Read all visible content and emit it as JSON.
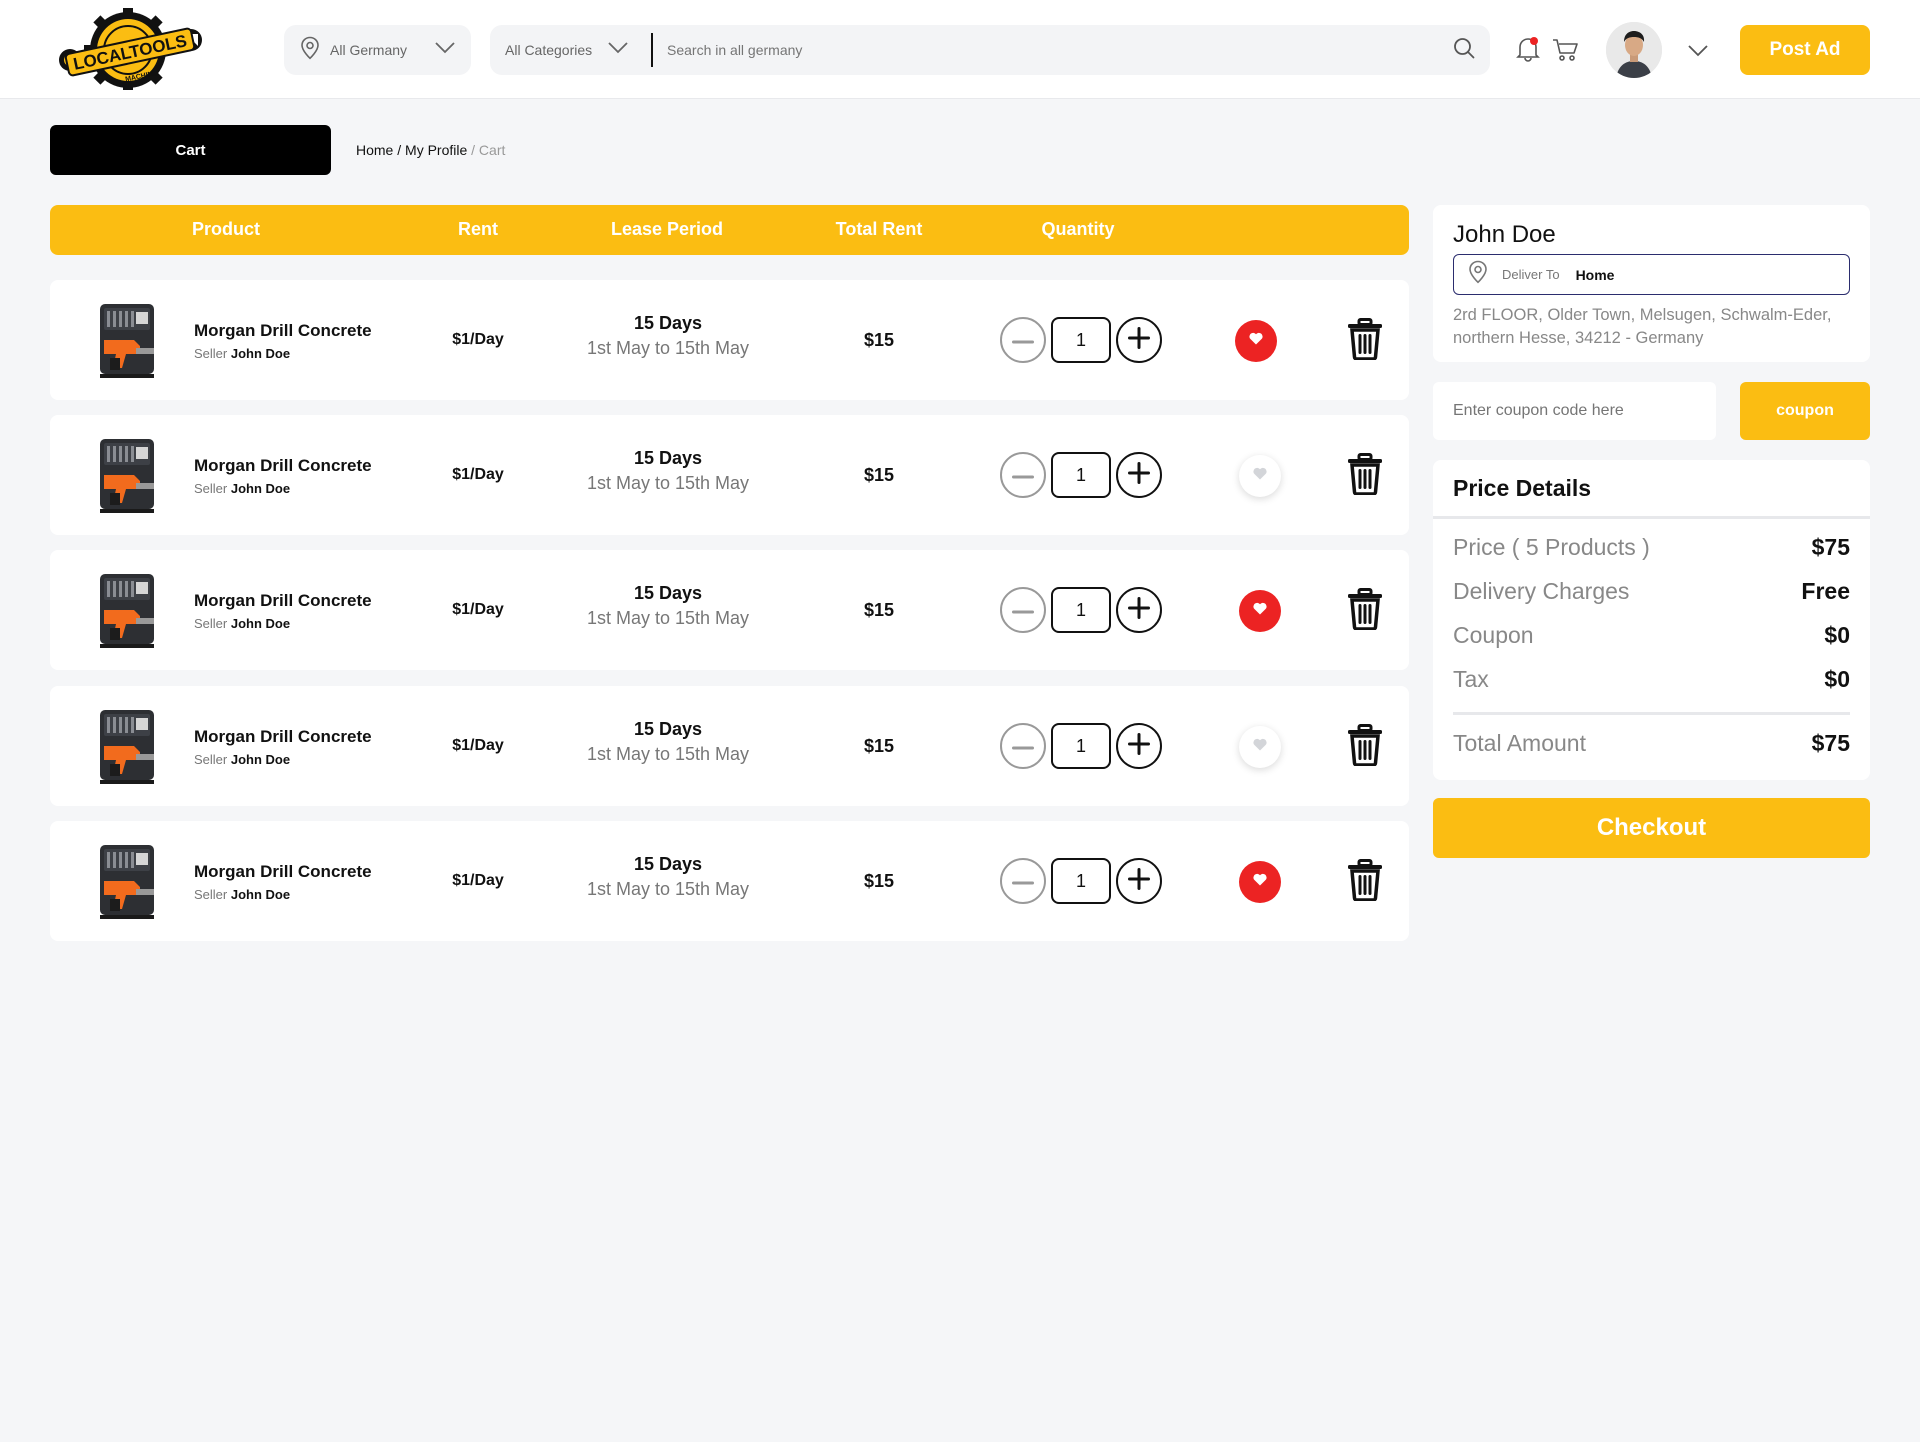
{
  "brand": {
    "logo_text": "LOCALTOOLS",
    "logo_subtext": "MACHINE"
  },
  "header": {
    "location": "All Germany",
    "category": "All Categories",
    "search_placeholder": "Search in all germany",
    "post_ad_label": "Post Ad"
  },
  "page": {
    "tab_label": "Cart",
    "breadcrumb_home": "Home",
    "breadcrumb_sep1": " / ",
    "breadcrumb_profile": "My Profile",
    "breadcrumb_current": " / Cart"
  },
  "table": {
    "columns": [
      "Product",
      "Rent",
      "Lease Period",
      "Total Rent",
      "Quantity"
    ],
    "rows": [
      {
        "product": "Morgan Drill Concrete",
        "seller_label": "Seller",
        "seller": "John Doe",
        "rent": "$1/Day",
        "days": "15 Days",
        "range": "1st May to 15th May",
        "total": "$15",
        "quantity": "1",
        "favorite": true
      },
      {
        "product": "Morgan Drill Concrete",
        "seller_label": "Seller",
        "seller": "John Doe",
        "rent": "$1/Day",
        "days": "15 Days",
        "range": "1st May to 15th May",
        "total": "$15",
        "quantity": "1",
        "favorite": false
      },
      {
        "product": "Morgan Drill Concrete",
        "seller_label": "Seller",
        "seller": "John Doe",
        "rent": "$1/Day",
        "days": "15 Days",
        "range": "1st May to 15th May",
        "total": "$15",
        "quantity": "1",
        "favorite": true
      },
      {
        "product": "Morgan Drill Concrete",
        "seller_label": "Seller",
        "seller": "John Doe",
        "rent": "$1/Day",
        "days": "15 Days",
        "range": "1st May to 15th May",
        "total": "$15",
        "quantity": "1",
        "favorite": false
      },
      {
        "product": "Morgan Drill Concrete",
        "seller_label": "Seller",
        "seller": "John Doe",
        "rent": "$1/Day",
        "days": "15 Days",
        "range": "1st May to 15th May",
        "total": "$15",
        "quantity": "1",
        "favorite": true
      }
    ]
  },
  "address": {
    "name": "John Doe",
    "deliver_label": "Deliver To",
    "deliver_value": "Home",
    "text": "2rd FLOOR,  Older Town, Melsugen,  Schwalm-Eder, northern Hesse,  34212 - Germany"
  },
  "coupon": {
    "placeholder": "Enter coupon code here",
    "button": "coupon"
  },
  "price_details": {
    "title": "Price Details",
    "rows": [
      {
        "label": "Price ( 5 Products )",
        "value": "$75"
      },
      {
        "label": "Delivery Charges",
        "value": "Free"
      },
      {
        "label": "Coupon",
        "value": "$0"
      },
      {
        "label": "Tax",
        "value": "$0"
      }
    ],
    "total_label": "Total Amount",
    "total_value": "$75"
  },
  "checkout_label": "Checkout",
  "colors": {
    "accent": "#fbbd12",
    "favorite": "#ec2323",
    "dark": "#000000"
  },
  "icons": [
    "location-pin-icon",
    "chevron-down-icon",
    "search-icon",
    "bell-icon",
    "cart-icon",
    "heart-icon",
    "trash-icon",
    "minus-icon",
    "plus-icon"
  ]
}
